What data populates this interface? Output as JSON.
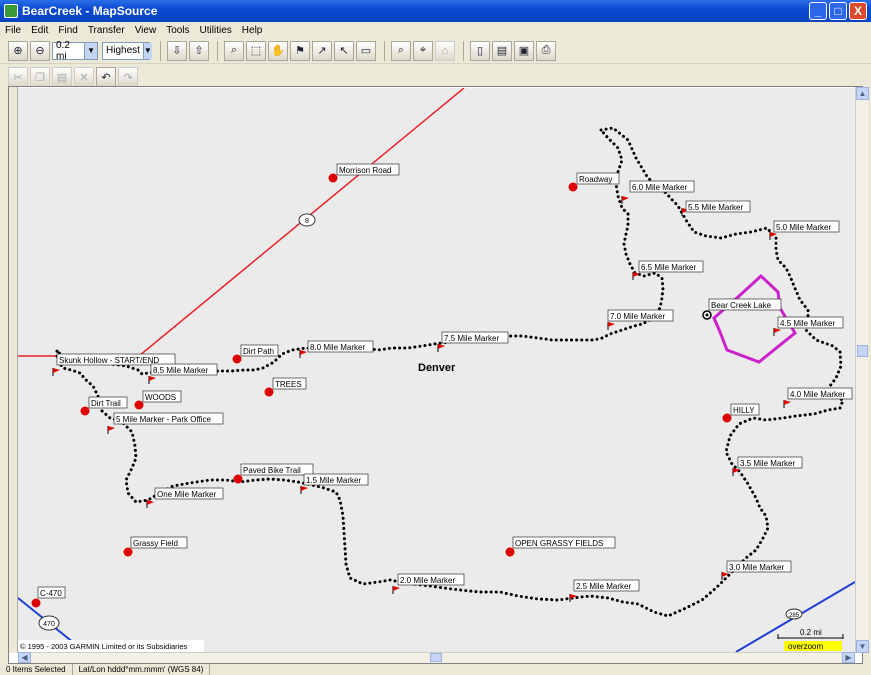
{
  "window": {
    "title": "BearCreek - MapSource",
    "controls": [
      "_",
      "□",
      "X"
    ]
  },
  "menu": [
    "File",
    "Edit",
    "Find",
    "Transfer",
    "View",
    "Tools",
    "Utilities",
    "Help"
  ],
  "toolbar": {
    "zoom_value": "0.2 mi",
    "detail_value": "Highest"
  },
  "map": {
    "city_label": "Denver",
    "road_shield": "8",
    "highway_shield": "470",
    "highway_shield_right": "285",
    "copyright": "© 1995 - 2003 GARMIN Limited or its Subsidiaries",
    "scale_text": "0.2 mi",
    "overzoom": "overzoom",
    "points": [
      "Morrison Road",
      "Roadway",
      "Dirt Path",
      "TREES",
      "WOODS",
      "Dirt Trail",
      "HILLY",
      "Paved Bike Trail",
      "Grassy Field",
      "OPEN GRASSY FIELDS",
      "C-470"
    ],
    "markers": [
      "6.0 Mile Marker",
      "5.5 Mile Marker",
      "5.0 Mile Marker",
      "6.5 Mile Marker",
      "7.0 Mile Marker",
      "Bear Creek Lake",
      "4.5 Mile Marker",
      "8.0 Mile Marker",
      "7.5 Mile Marker",
      "Skunk Hollow - START/END",
      "8.5 Mile Marker",
      "5 Mile Marker - Park Office",
      "4.0 Mile Marker",
      "3.5 Mile Marker",
      "1.5 Mile Marker",
      "One Mile Marker",
      "3.0 Mile Marker",
      "2.0 Mile Marker",
      "2.5 Mile Marker"
    ]
  },
  "status": {
    "selection": "0 Items Selected",
    "coord_format": "Lat/Lon hddd°mm.mmm' (WGS 84)"
  },
  "colors": {
    "road_red": "#e8242a",
    "highway_blue": "#1e3fd4",
    "trail": "#000000",
    "lake": "#cc22cc",
    "waypoint": "#dd0000",
    "overzoom_bg": "#ffff00"
  }
}
